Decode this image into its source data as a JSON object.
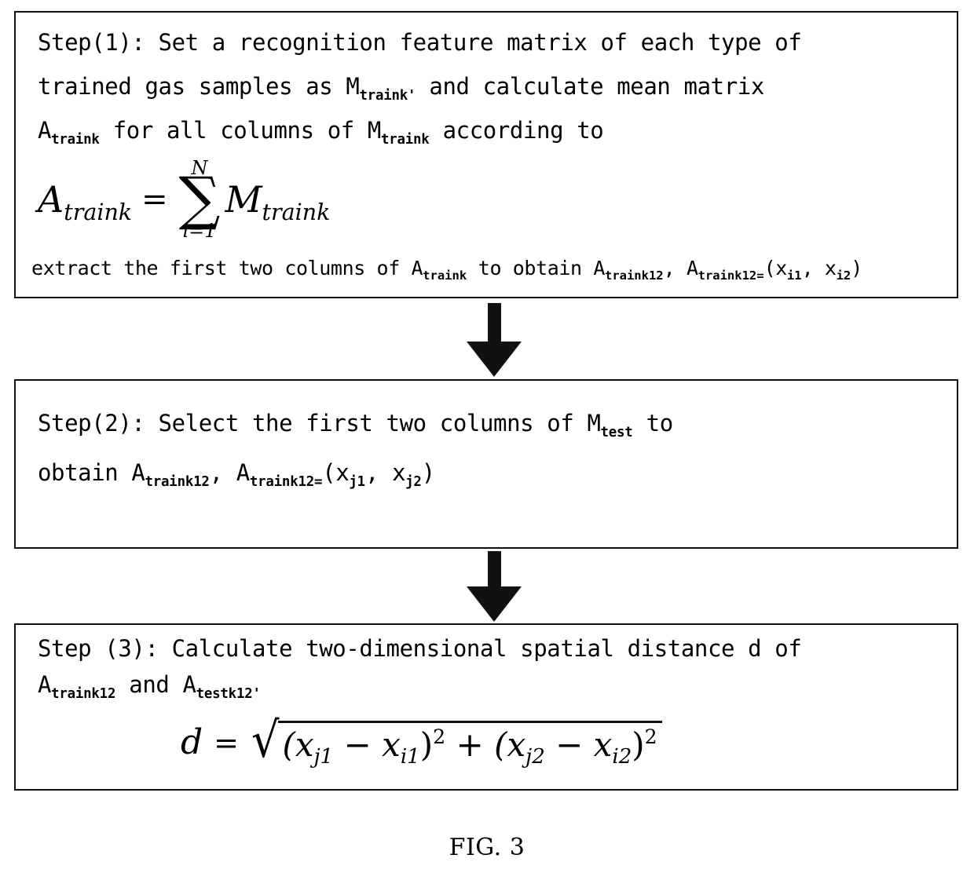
{
  "figure": {
    "caption": "FIG. 3",
    "ink_color": "#111111",
    "background_color": "#ffffff"
  },
  "steps": [
    {
      "id": "step1",
      "label": "Step(1)",
      "lines": [
        {
          "pre": "Step(1): Set a recognition feature matrix of each type of"
        },
        {
          "pre": "trained gas samples as M",
          "sub": "traink'",
          "post": " and calculate mean matrix"
        },
        {
          "pre": "A",
          "sub": "traink",
          "post": " for all columns of M",
          "sub2": "traink",
          "post2": " according to"
        }
      ],
      "formula": {
        "lhs_base": "A",
        "lhs_sub": "traink",
        "equals": "=",
        "sum_upper": "N",
        "sum_symbol": "∑",
        "sum_lower": "i=1",
        "rhs_base": "M",
        "rhs_sub": "traink"
      },
      "tail_line": {
        "p1": "extract the first two columns of A",
        "s1": "traink",
        "p2": " to obtain A",
        "s2": "traink12",
        "p3": ",  A",
        "s3": "traink12=",
        "p4": "(x",
        "s4": "i1",
        "p5": ", x",
        "s5": "i2",
        "p6": ")"
      }
    },
    {
      "id": "step2",
      "label": "Step(2)",
      "lines": [
        {
          "pre": "Step(2): Select the first two columns of M",
          "sub": "test",
          "post": " to"
        },
        {
          "pre": "obtain A",
          "sub": "traink12",
          "post": ",  A",
          "sub2": "traink12=",
          "post2": "(x",
          "sub3": "j1",
          "post3": ", x",
          "sub4": "j2",
          "post4": ")"
        }
      ]
    },
    {
      "id": "step3",
      "label": "Step (3)",
      "lines": [
        {
          "pre": "Step (3): Calculate two-dimensional spatial distance d of"
        },
        {
          "pre": "  A",
          "sub": "traink12",
          "post": " and A",
          "sub2": "testk12'"
        }
      ],
      "formula": {
        "lhs": "d",
        "equals": "=",
        "radical": "√",
        "term1_open": "(x",
        "term1_sub_a": "j1",
        "term1_minus": " − x",
        "term1_sub_b": "i1",
        "term1_close": ")",
        "term1_exp": "2",
        "plus": " + ",
        "term2_open": "(x",
        "term2_sub_a": "j2",
        "term2_minus": " − x",
        "term2_sub_b": "i2",
        "term2_close": ")",
        "term2_exp": "2"
      }
    }
  ],
  "arrows": [
    {
      "name": "arrow-step1-to-step2",
      "direction": "down"
    },
    {
      "name": "arrow-step2-to-step3",
      "direction": "down"
    }
  ]
}
